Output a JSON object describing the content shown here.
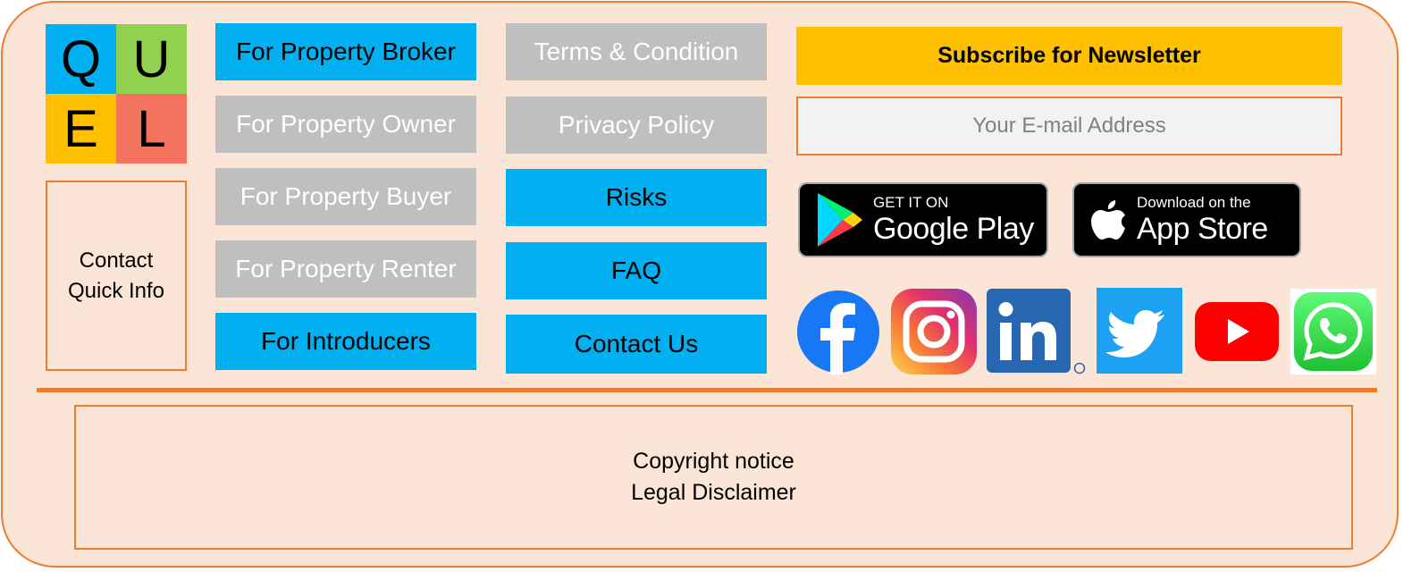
{
  "logo": {
    "letters": [
      "Q",
      "U",
      "E",
      "L"
    ],
    "colors": [
      "#00b0f0",
      "#92d050",
      "#ffc000",
      "#f4735f"
    ]
  },
  "contact_info": {
    "line1": "Contact",
    "line2": "Quick Info"
  },
  "nav_left": [
    {
      "label": "For Property Broker",
      "style": "blue"
    },
    {
      "label": "For Property Owner",
      "style": "gray"
    },
    {
      "label": "For Property Buyer",
      "style": "gray"
    },
    {
      "label": "For Property Renter",
      "style": "gray"
    },
    {
      "label": "For Introducers",
      "style": "blue"
    }
  ],
  "nav_right": [
    {
      "label": "Terms & Condition",
      "style": "gray"
    },
    {
      "label": "Privacy Policy",
      "style": "gray"
    },
    {
      "label": "Risks",
      "style": "blue"
    },
    {
      "label": "FAQ",
      "style": "blue"
    },
    {
      "label": "Contact Us",
      "style": "blue"
    }
  ],
  "newsletter": {
    "title": "Subscribe for Newsletter",
    "placeholder": "Your E-mail Address"
  },
  "stores": {
    "google_play": {
      "small": "GET IT ON",
      "big": "Google Play",
      "icon": "google-play-icon"
    },
    "app_store": {
      "small": "Download on the",
      "big": "App Store",
      "icon": "apple-icon"
    }
  },
  "social": [
    "facebook-icon",
    "instagram-icon",
    "linkedin-icon",
    "twitter-icon",
    "youtube-icon",
    "whatsapp-icon"
  ],
  "legal": {
    "line1": "Copyright notice",
    "line2": "Legal Disclaimer"
  },
  "colors": {
    "accent": "#ed7d31",
    "background": "#fbe5d6",
    "blue": "#00b0f0",
    "gray": "#bfbfbf",
    "yellow": "#ffc000"
  }
}
